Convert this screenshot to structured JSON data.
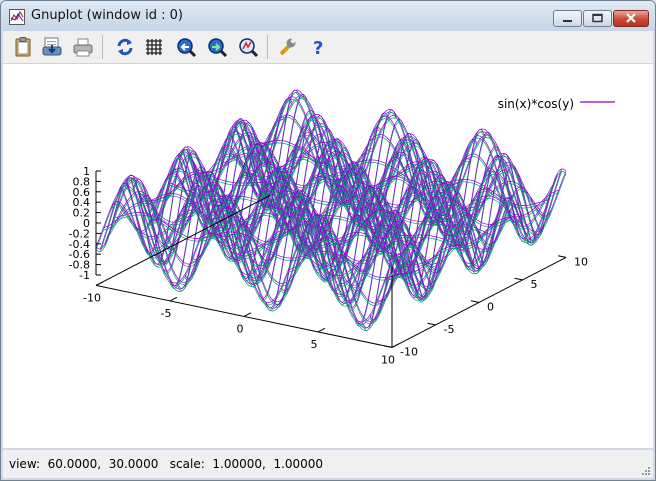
{
  "window": {
    "title": "Gnuplot (window id : 0)"
  },
  "toolbar": {
    "buttons": [
      {
        "name": "copy-to-clipboard",
        "icon": "clipboard-icon"
      },
      {
        "name": "save",
        "icon": "save-icon"
      },
      {
        "name": "print",
        "icon": "printer-icon"
      },
      {
        "name": "replot",
        "icon": "refresh-icon"
      },
      {
        "name": "grid",
        "icon": "grid-icon"
      },
      {
        "name": "previous-zoom",
        "icon": "zoom-previous-icon"
      },
      {
        "name": "next-zoom",
        "icon": "zoom-next-icon"
      },
      {
        "name": "autoscale",
        "icon": "zoom-autoscale-icon"
      },
      {
        "name": "options",
        "icon": "wrench-icon"
      },
      {
        "name": "help",
        "icon": "help-icon"
      }
    ]
  },
  "plot": {
    "legend_label": "sin(x)*cos(y)",
    "colors": {
      "top_surface": "#9400d3",
      "bottom_surface": "#009e73",
      "axes": "#000000"
    },
    "z_ticks": [
      "1",
      "0.8",
      "0.6",
      "0.4",
      "0.2",
      "0",
      "-0.2",
      "-0.4",
      "-0.6",
      "-0.8",
      "-1"
    ],
    "x_ticks": [
      "-10",
      "-5",
      "0",
      "5",
      "10"
    ],
    "y_ticks": [
      "-10",
      "-5",
      "0",
      "5",
      "10"
    ]
  },
  "chart_data": {
    "type": "surface",
    "function": "sin(x)*cos(y)",
    "series": [
      {
        "name": "sin(x)*cos(y)"
      }
    ],
    "xlim": [
      -10,
      10
    ],
    "ylim": [
      -10,
      10
    ],
    "zlim": [
      -1,
      1
    ],
    "view": {
      "rot_x": 60,
      "rot_z": 30,
      "scale": 1,
      "scale_z": 1
    },
    "grid": false,
    "legend": "top-right"
  },
  "status": {
    "text": "view:  60.0000,  30.0000   scale:  1.00000,  1.00000"
  }
}
